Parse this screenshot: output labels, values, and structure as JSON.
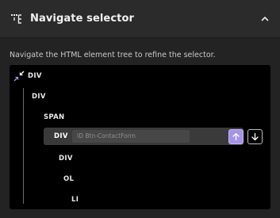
{
  "header": {
    "title": "Navigate selector",
    "icon": "selector-tree-icon",
    "collapse_icon": "chevron-up-icon"
  },
  "description": "Navigate the HTML element tree to refine the selector.",
  "tree": {
    "collapse_icon": "collapse-arrows-icon",
    "nodes": [
      {
        "tag": "DIV"
      },
      {
        "tag": "DIV"
      },
      {
        "tag": "SPAN"
      },
      {
        "tag": "DIV",
        "selected": true,
        "id_placeholder": "ID Btn-ContactForm"
      },
      {
        "tag": "DIV"
      },
      {
        "tag": "OL"
      },
      {
        "tag": "LI"
      }
    ],
    "up_icon": "arrow-up-icon",
    "down_icon": "arrow-down-icon"
  },
  "colors": {
    "accent": "#a593e6",
    "panel": "#232323",
    "tree_bg": "#000000"
  }
}
